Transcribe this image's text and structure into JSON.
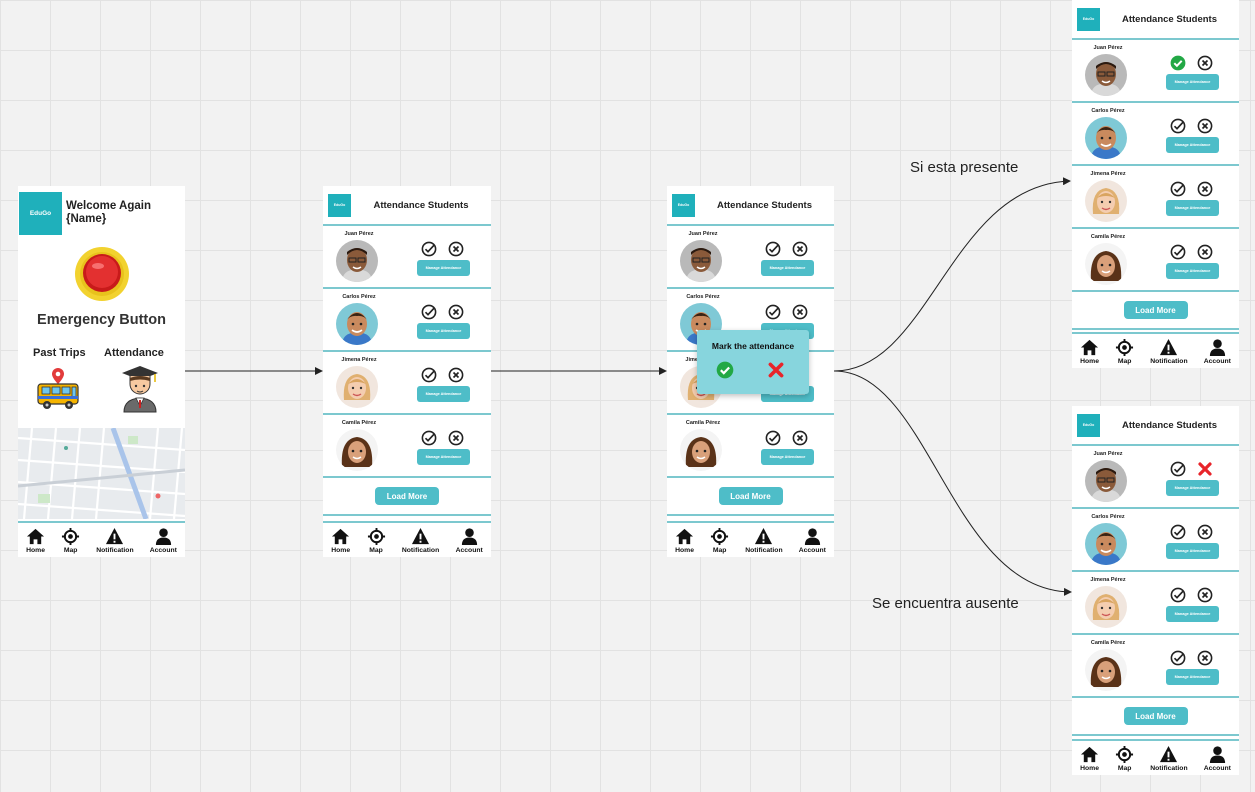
{
  "home": {
    "logo_text": "EduGo",
    "welcome": "Welcome Again",
    "welcome_name": "{Name}",
    "emergency_label": "Emergency Button",
    "past_trips_label": "Past Trips",
    "attendance_label": "Attendance"
  },
  "attendance": {
    "logo_text": "EduGo",
    "title": "Attendance Students",
    "manage_label": "Manage Attendance",
    "load_more": "Load More",
    "students": [
      {
        "name": "Juan Pérez"
      },
      {
        "name": "Carlos Pérez"
      },
      {
        "name": "Jimena Pérez"
      },
      {
        "name": "Camila Pérez"
      }
    ]
  },
  "popup": {
    "title": "Mark the attendance"
  },
  "nav": {
    "home": "Home",
    "map": "Map",
    "notification": "Notification",
    "account": "Account"
  },
  "edges": {
    "present": "Si esta presente",
    "absent": "Se encuentra ausente"
  },
  "colors": {
    "accent": "#4ebdc8",
    "divider": "#7cc8cf",
    "logo": "#1fb0bb",
    "present": "#22a845",
    "absent": "#e8242a"
  }
}
